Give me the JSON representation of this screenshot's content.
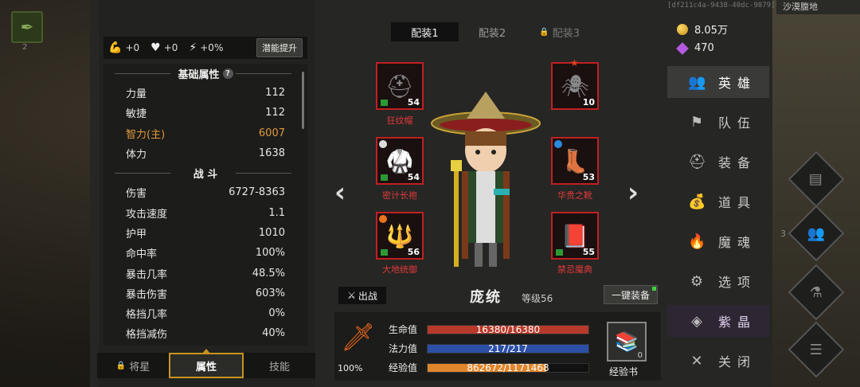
{
  "hud": {
    "top_left_badge": "2",
    "session_id": "[df211c4a-9438-40dc-9879]",
    "map_name": "沙漠腹地",
    "right_counter": "3"
  },
  "bonus_bar": {
    "strength_bonus": "+0",
    "hp_bonus": "+0",
    "energy_bonus": "+0%",
    "potential_button": "潜能提升"
  },
  "stats": {
    "base_header": "基础属性",
    "base": [
      {
        "label": "力量",
        "value": "112"
      },
      {
        "label": "敏捷",
        "value": "112"
      },
      {
        "label": "智力(主)",
        "value": "6007"
      },
      {
        "label": "体力",
        "value": "1638"
      }
    ],
    "combat_header": "战 斗",
    "combat": [
      {
        "label": "伤害",
        "value": "6727-8363"
      },
      {
        "label": "攻击速度",
        "value": "1.1"
      },
      {
        "label": "护甲",
        "value": "1010"
      },
      {
        "label": "命中率",
        "value": "100%"
      },
      {
        "label": "暴击几率",
        "value": "48.5%"
      },
      {
        "label": "暴击伤害",
        "value": "603%"
      },
      {
        "label": "格挡几率",
        "value": "0%"
      },
      {
        "label": "格挡减伤",
        "value": "40%"
      }
    ]
  },
  "bottom_tabs": [
    {
      "label": "将星",
      "locked": true
    },
    {
      "label": "属性",
      "active": true
    },
    {
      "label": "技能"
    }
  ],
  "loadout_tabs": [
    {
      "label": "配装1",
      "active": true
    },
    {
      "label": "配装2"
    },
    {
      "label": "配装3",
      "locked": true
    }
  ],
  "equipment": {
    "helmet": {
      "name": "狂纹帽",
      "level": "54",
      "icon": "helmet-icon"
    },
    "armor": {
      "name": "密计长袍",
      "level": "54",
      "icon": "robe-icon"
    },
    "weapon": {
      "name": "大地统御",
      "level": "56",
      "icon": "staff-icon"
    },
    "pet": {
      "name": "",
      "level": "10",
      "icon": "spider-pet-icon"
    },
    "boots": {
      "name": "华贵之靴",
      "level": "53",
      "icon": "boots-icon"
    },
    "offhand": {
      "name": "禁忌魔典",
      "level": "55",
      "icon": "tome-icon"
    }
  },
  "hero": {
    "deploy_label": "出战",
    "name": "庞统",
    "level": "等级56",
    "equip_all": "一键装备",
    "power_pct": "100%",
    "hp_label": "生命值",
    "hp": "16380/16380",
    "hp_ratio": 1.0,
    "mp_label": "法力值",
    "mp": "217/217",
    "mp_ratio": 1.0,
    "exp_label": "经验值",
    "exp": "862672/1171468",
    "exp_ratio": 0.736,
    "exp_book_label": "经验书",
    "exp_book_count": "0"
  },
  "currency": {
    "gold": "8.05万",
    "gems": "470"
  },
  "menu": [
    {
      "label": "英雄",
      "icon": "heroes-icon",
      "active": true
    },
    {
      "label": "队伍",
      "icon": "flag-icon"
    },
    {
      "label": "装备",
      "icon": "helmet-icon"
    },
    {
      "label": "道具",
      "icon": "bag-icon"
    },
    {
      "label": "魔魂",
      "icon": "flame-icon"
    },
    {
      "label": "选项",
      "icon": "gear-icon"
    },
    {
      "label": "紫晶",
      "icon": "crystal-icon",
      "purple": true
    },
    {
      "label": "关闭",
      "icon": "close-icon"
    }
  ],
  "colors": {
    "accent_gold": "#c8941e",
    "hp": "#c0392b",
    "mp": "#2c4fa8",
    "exp": "#e0862c",
    "item_red": "#e03a3a"
  }
}
